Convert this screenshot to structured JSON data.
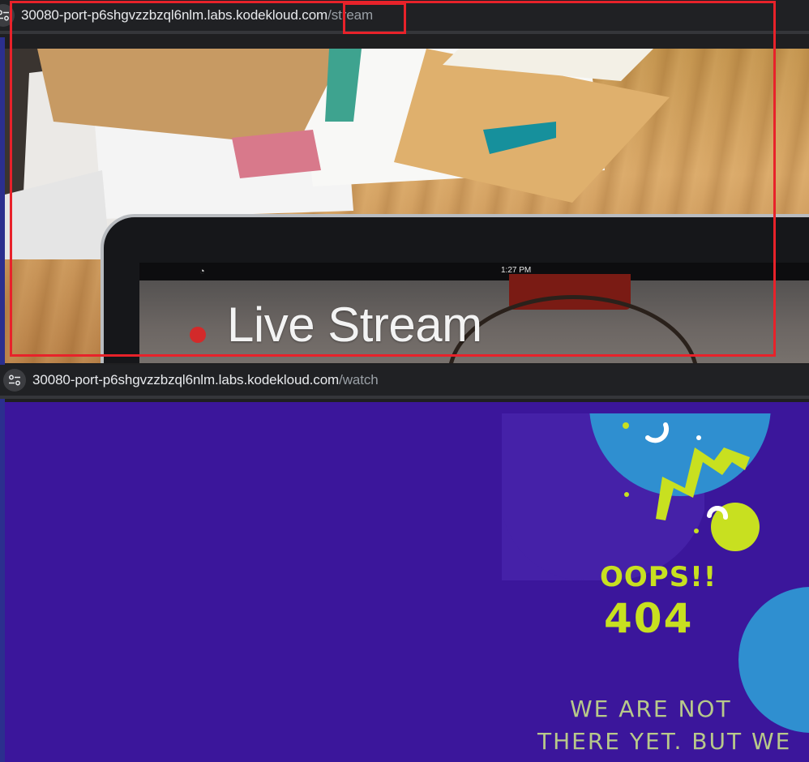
{
  "top_tab": {
    "url_host": "30080-port-p6shgvzzbzql6nlm.labs.kodekloud.com",
    "url_path": "/stream"
  },
  "stream_page": {
    "screen_time": "1:27 PM",
    "title": "Live Stream"
  },
  "bottom_tab": {
    "url_host": "30080-port-p6shgvzzbzql6nlm.labs.kodekloud.com",
    "url_path": "/watch"
  },
  "error_page": {
    "oops": "OOPS!!",
    "code": "404",
    "message_line_1": "We are not",
    "message_line_2": "there yet. But we"
  },
  "colors": {
    "annotation": "#e8222a",
    "error_bg": "#3b169b",
    "accent_lime": "#c8e020",
    "accent_blue": "#2f8fd0"
  }
}
